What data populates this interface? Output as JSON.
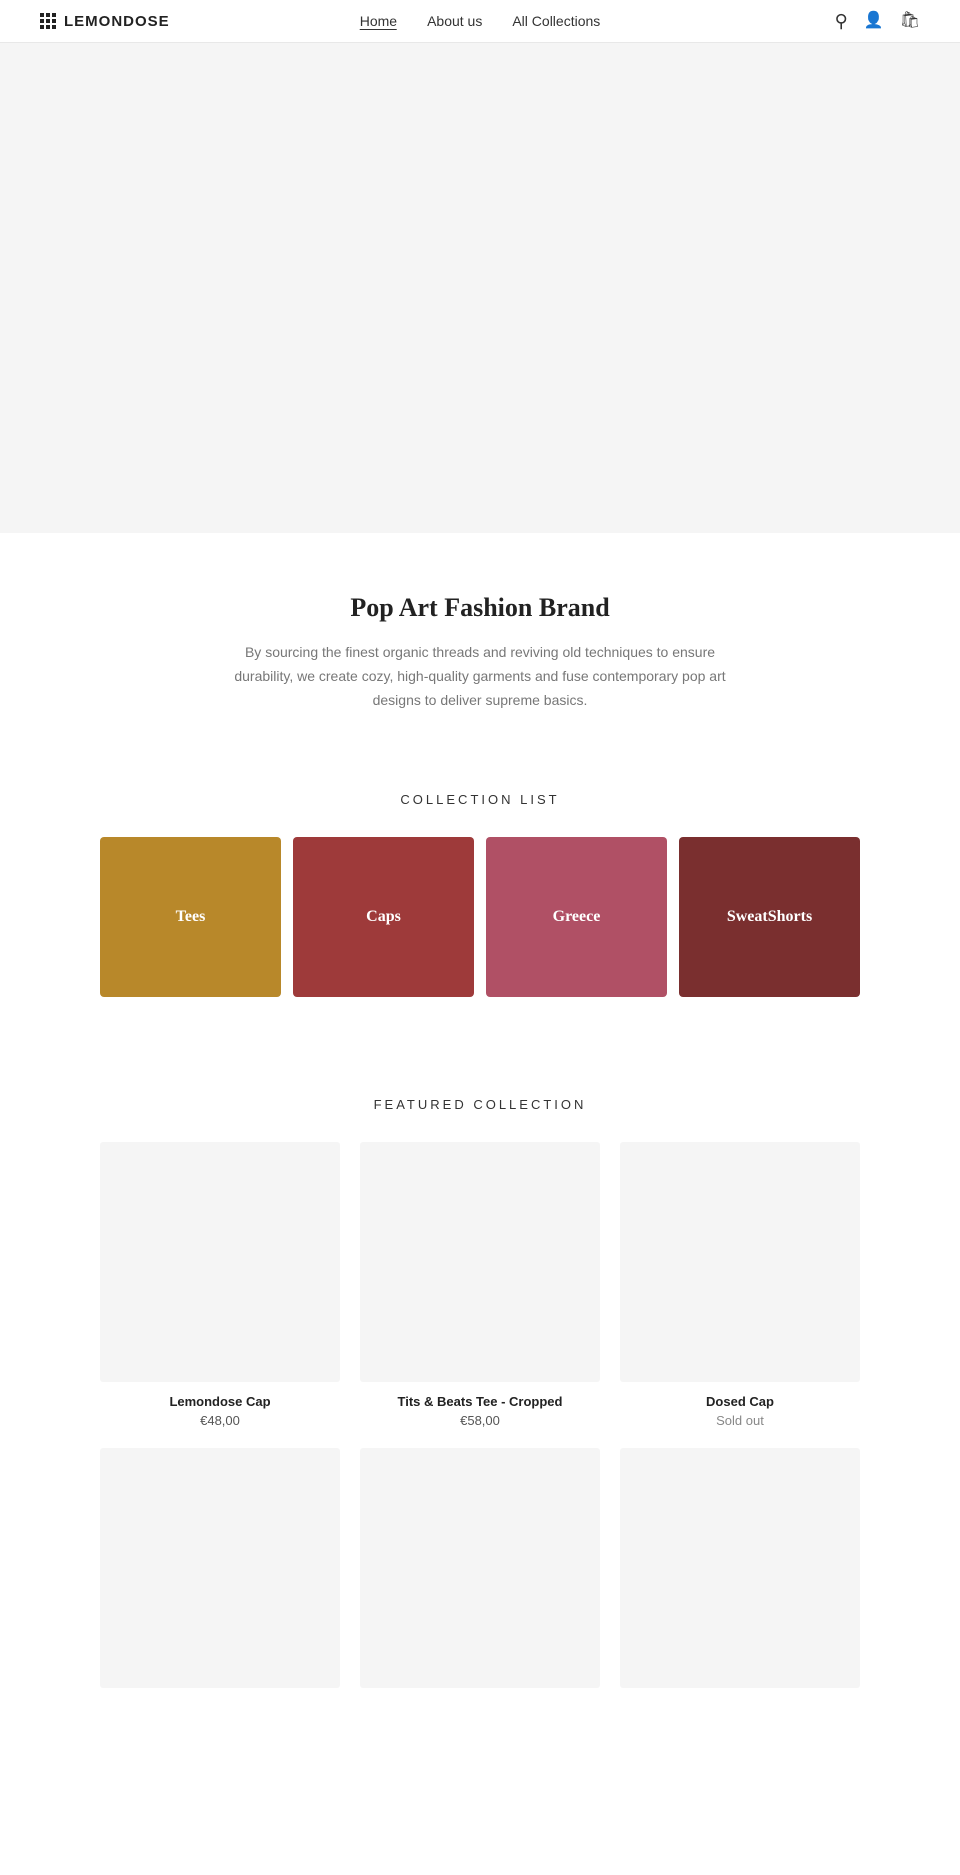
{
  "header": {
    "logo_text": "LEMONDOSE",
    "nav": [
      {
        "label": "Home",
        "active": true
      },
      {
        "label": "About us",
        "active": false
      },
      {
        "label": "All Collections",
        "active": false
      }
    ],
    "search_icon": "search",
    "account_icon": "user",
    "cart_icon": "cart"
  },
  "brand": {
    "title": "Pop Art Fashion Brand",
    "description": "By sourcing the finest organic threads and reviving old techniques to ensure durability, we create cozy, high-quality garments and fuse contemporary pop art designs to deliver supreme basics."
  },
  "collection_list": {
    "section_title": "COLLECTION LIST",
    "items": [
      {
        "label": "Tees",
        "color": "#b8882a"
      },
      {
        "label": "Caps",
        "color": "#9e3a3a"
      },
      {
        "label": "Greece",
        "color": "#b05065"
      },
      {
        "label": "SweatShorts",
        "color": "#7a2f2f"
      }
    ]
  },
  "featured": {
    "section_title": "FEATURED COLLECTION",
    "products": [
      {
        "name": "Lemondose Cap",
        "price": "€48,00",
        "sold_out": false
      },
      {
        "name": "Tits & Beats Tee - Cropped",
        "price": "€58,00",
        "sold_out": false
      },
      {
        "name": "Dosed Cap",
        "price": "Sold out",
        "sold_out": true
      },
      {
        "name": "",
        "price": "",
        "sold_out": false
      },
      {
        "name": "",
        "price": "",
        "sold_out": false
      },
      {
        "name": "",
        "price": "",
        "sold_out": false
      }
    ]
  }
}
